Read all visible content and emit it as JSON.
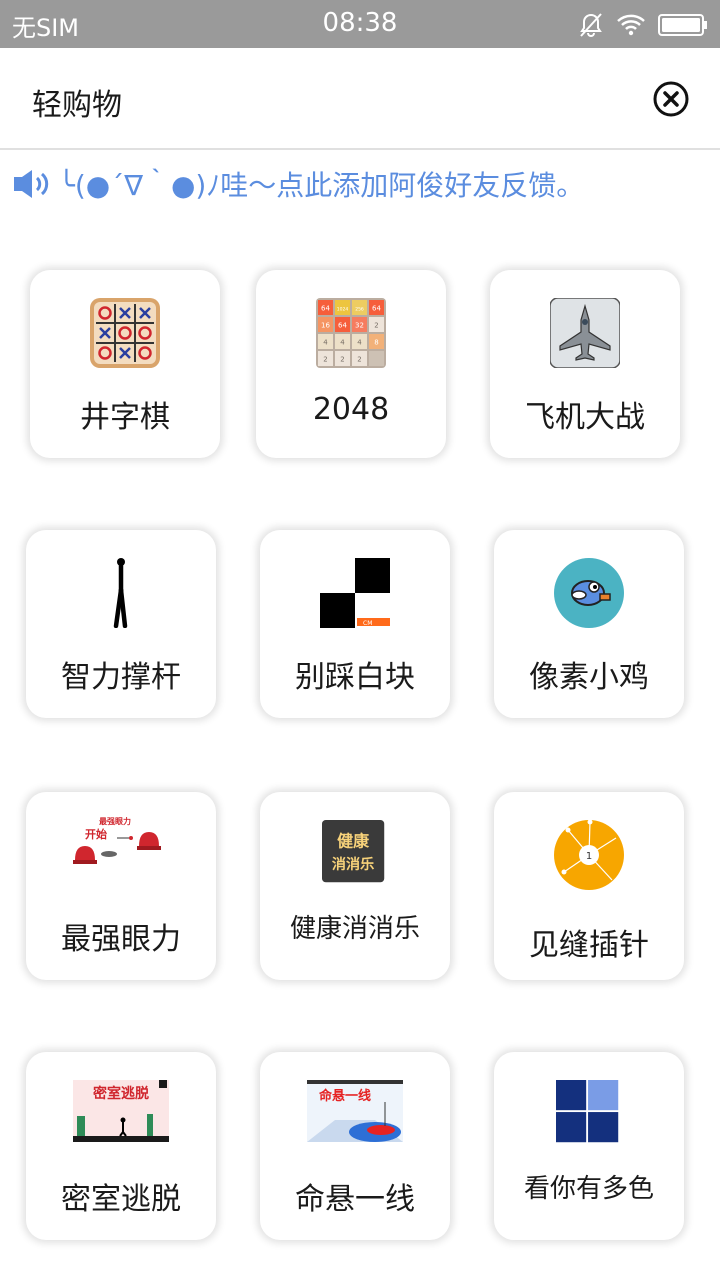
{
  "status_bar": {
    "carrier": "无SIM",
    "time": "08:38"
  },
  "header": {
    "title": "轻购物"
  },
  "notice": {
    "text": "╰(●´∇｀●)ﾉ哇～点此添加阿俊好友反馈。",
    "color": "#5b8ddf"
  },
  "games": [
    {
      "label": "井字棋",
      "icon": "tic-tac-toe-icon"
    },
    {
      "label": "2048",
      "icon": "2048-icon"
    },
    {
      "label": "飞机大战",
      "icon": "fighter-jet-icon"
    },
    {
      "label": "智力撑杆",
      "icon": "stick-figure-icon"
    },
    {
      "label": "别踩白块",
      "icon": "piano-tiles-icon"
    },
    {
      "label": "像素小鸡",
      "icon": "pixel-bird-icon"
    },
    {
      "label": "最强眼力",
      "icon": "cups-game-icon",
      "banner": "最强眼力",
      "start": "开始"
    },
    {
      "label": "健康消消乐",
      "icon": "match-game-icon",
      "badge_line1": "健康",
      "badge_line2": "消消乐"
    },
    {
      "label": "见缝插针",
      "icon": "pin-circle-icon",
      "number": "1"
    },
    {
      "label": "密室逃脱",
      "icon": "escape-room-icon",
      "banner": "密室逃脱"
    },
    {
      "label": "命悬一线",
      "icon": "hanging-line-icon",
      "banner": "命悬一线"
    },
    {
      "label": "看你有多色",
      "icon": "color-grid-icon"
    }
  ],
  "icon_2048_tiles": [
    "64",
    "1024",
    "256",
    "64",
    "16",
    "64",
    "32",
    "2",
    "4",
    "4",
    "4",
    "8",
    "2",
    "2",
    "2",
    ""
  ]
}
